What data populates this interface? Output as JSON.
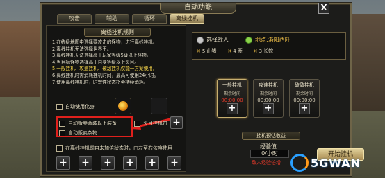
{
  "window": {
    "title": "自动功能",
    "close_label": "X"
  },
  "tabs": [
    {
      "label": "攻击",
      "active": false
    },
    {
      "label": "辅助",
      "active": false
    },
    {
      "label": "循环",
      "active": false
    },
    {
      "label": "离线挂机",
      "active": true
    }
  ],
  "rules_panel": {
    "header": "离线挂机规则",
    "rules": [
      {
        "text": "1.在练级地图中选择要攻击的怪物，进行离线挂机。",
        "highlight": false
      },
      {
        "text": "2.离线挂机无法选择世界王。",
        "highlight": false
      },
      {
        "text": "3.离线挂机无法选择高于玩家等级5级以上怪物。",
        "highlight": false
      },
      {
        "text": "4.当目标怪物选择高于自身等级以上头目。",
        "highlight": false
      },
      {
        "text": "5.一般挂机、攻速挂机、破敌挂机仅能一方案使用。",
        "highlight": true
      },
      {
        "text": "6.离线挂机时需消耗挂机时间，最高可使用24小时。",
        "highlight": false
      },
      {
        "text": "7.使用离线挂机时，时效性状态将会持续消耗。",
        "highlight": false
      }
    ]
  },
  "options": {
    "auto_transform": "自动使用化身",
    "auto_sell_blue": "自动贩卖蓝装以下装备",
    "boss_talisman": "头目挂机符",
    "auto_sell_misc": "自动贩卖杂物",
    "offline_note": "在离线挂机前自未加倍状态时，由左至右依序使用",
    "plus": "+"
  },
  "targets_panel": {
    "select_label": "选择敌人",
    "location_label": "地点:洛阳西阡",
    "targets": [
      {
        "count": "5",
        "name": "山猪"
      },
      {
        "count": "4",
        "name": "鹿"
      },
      {
        "count": "3",
        "name": "长蛇"
      }
    ]
  },
  "modes": [
    {
      "name": "一般挂机",
      "sub": "剩余时间",
      "time": "00:00:00",
      "active": true
    },
    {
      "name": "攻速挂机",
      "sub": "剩余时间",
      "time": "00:00:00",
      "active": false
    },
    {
      "name": "破敌挂机",
      "sub": "剩余时间",
      "time": "00:00:00",
      "active": false
    }
  ],
  "earnings": {
    "header": "挂机预估收益",
    "exp_label": "经验值",
    "exp_value": "0/小时",
    "note": "敌人经验倍增"
  },
  "start_button": "开始挂机",
  "watermark": "5GWAN"
}
